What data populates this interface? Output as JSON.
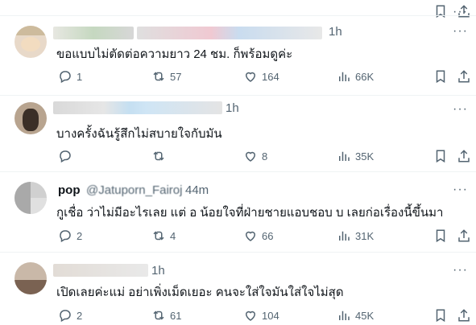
{
  "tweets": [
    {
      "handle": "",
      "time": "1h",
      "text": "ขอแบบไม่ตัดต่อความยาว 24 ชม. ก็พร้อมดูค่ะ",
      "replies": "1",
      "reposts": "57",
      "likes": "164",
      "views": "66K"
    },
    {
      "handle": "",
      "time": "1h",
      "text": "บางครั้งฉันรู้สึกไม่สบายใจกับมัน",
      "replies": "",
      "reposts": "",
      "likes": "8",
      "views": "35K"
    },
    {
      "name": "pop",
      "handle": "@Jatuporn_Fairoj",
      "time": "44m",
      "text": "กูเชื่อ ว่าไม่มีอะไรเลย แต่ อ น้อยใจที่ฝ่ายชายแอบชอบ บ เลยก่อเรื่องนี้ขึ้นมา",
      "replies": "2",
      "reposts": "4",
      "likes": "66",
      "views": "31K"
    },
    {
      "handle": "",
      "time": "1h",
      "text": "เปิดเลยค่ะแม่ อย่าเพิ่งเม็ดเยอะ คนจะใส่ใจมันใส่ใจไม่สุด",
      "replies": "2",
      "reposts": "61",
      "likes": "104",
      "views": "45K"
    }
  ],
  "more_label": "···",
  "icons": [
    "reply-icon",
    "repost-icon",
    "like-icon",
    "views-icon",
    "bookmark-icon",
    "share-icon",
    "more-icon"
  ]
}
